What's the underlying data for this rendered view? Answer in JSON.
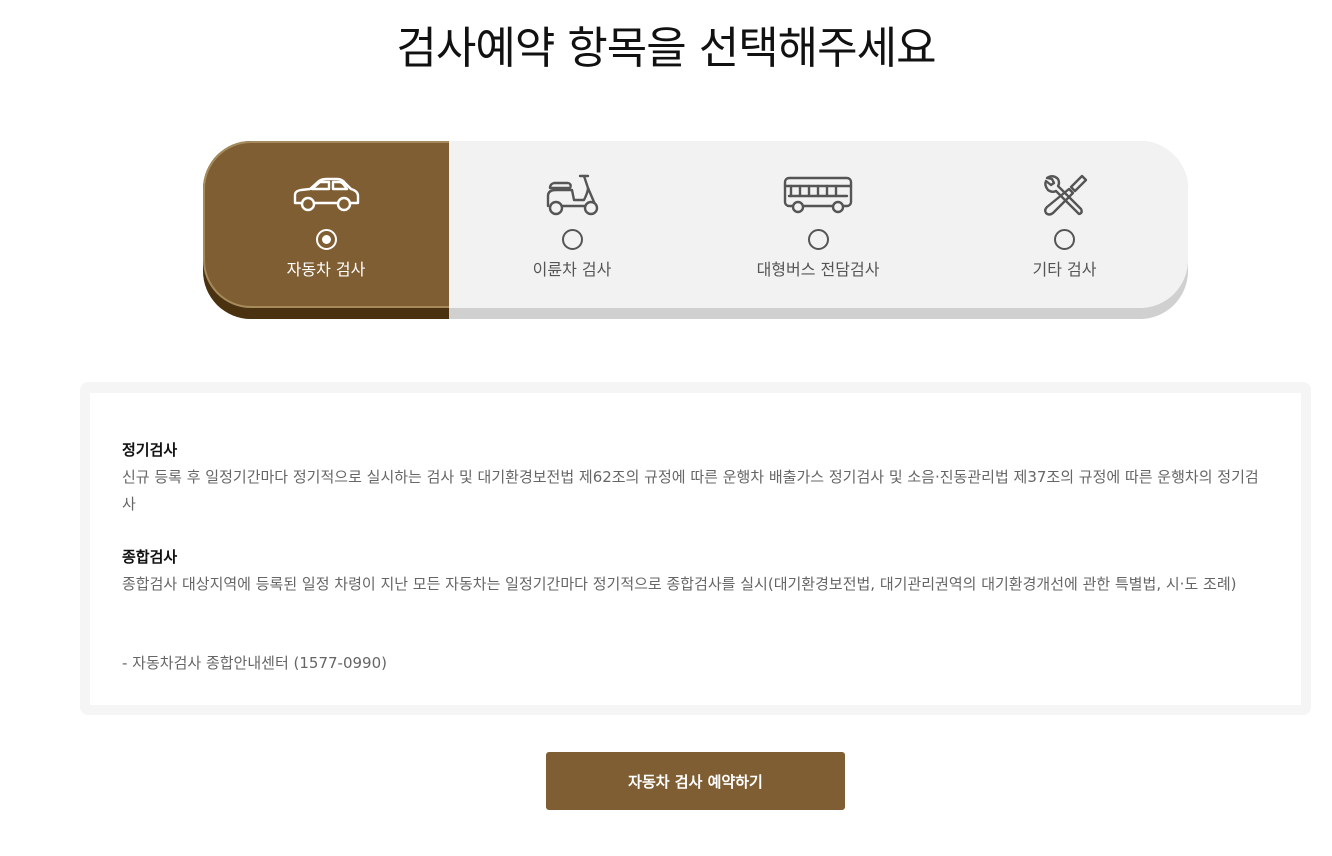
{
  "header": {
    "title": "검사예약 항목을 선택해주세요"
  },
  "categories": [
    {
      "label": "자동차 검사",
      "icon": "car-icon",
      "selected": true
    },
    {
      "label": "이륜차 검사",
      "icon": "scooter-icon",
      "selected": false
    },
    {
      "label": "대형버스 전담검사",
      "icon": "bus-icon",
      "selected": false
    },
    {
      "label": "기타 검사",
      "icon": "tools-icon",
      "selected": false
    }
  ],
  "info": {
    "sections": [
      {
        "heading": "정기검사",
        "text": "신규 등록 후 일정기간마다 정기적으로 실시하는 검사 및 대기환경보전법 제62조의 규정에 따른 운행차 배출가스 정기검사 및 소음·진동관리법 제37조의 규정에 따른 운행차의 정기검사"
      },
      {
        "heading": "종합검사",
        "text": "종합검사 대상지역에 등록된 일정 차령이 지난 모든 자동차는 일정기간마다 정기적으로 종합검사를 실시(대기환경보전법, 대기관리권역의 대기환경개선에 관한 특별법, 시·도 조례)"
      }
    ],
    "hotline": "- 자동차검사 종합안내센터 (1577-0990)"
  },
  "reserve_button": {
    "label": "자동차 검사 예약하기"
  },
  "colors": {
    "accent": "#7f5e33",
    "accent_dark": "#4a3210",
    "panel": "#f2f2f2"
  }
}
